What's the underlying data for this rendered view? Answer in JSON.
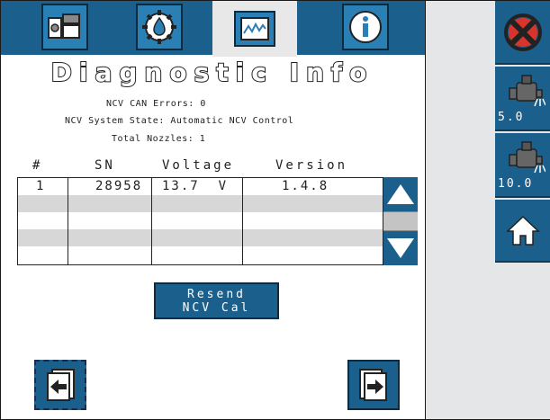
{
  "tabs": [
    {
      "icon": "machine-icon"
    },
    {
      "icon": "gear-droplet-icon"
    },
    {
      "icon": "graph-monitor-icon"
    },
    {
      "icon": "info-icon"
    }
  ],
  "title": "Diagnostic Info",
  "info": {
    "can_errors": "NCV CAN Errors: 0",
    "system_state": "NCV System State: Automatic NCV Control",
    "total_nozzles": "Total Nozzles: 1"
  },
  "table": {
    "columns": [
      "#",
      "SN",
      "Voltage",
      "Version"
    ],
    "rows": [
      {
        "num": "1",
        "sn": "28958",
        "voltage": "13.7  V",
        "version": "1.4.8"
      }
    ]
  },
  "resend_button": {
    "line1": "Resend",
    "line2": "NCV Cal"
  },
  "side": {
    "btn1_value": "5.0",
    "btn2_value": "10.0"
  },
  "colors": {
    "accent": "#1b5f8c",
    "panel": "#e4e6e8",
    "alert": "#d9342b"
  }
}
